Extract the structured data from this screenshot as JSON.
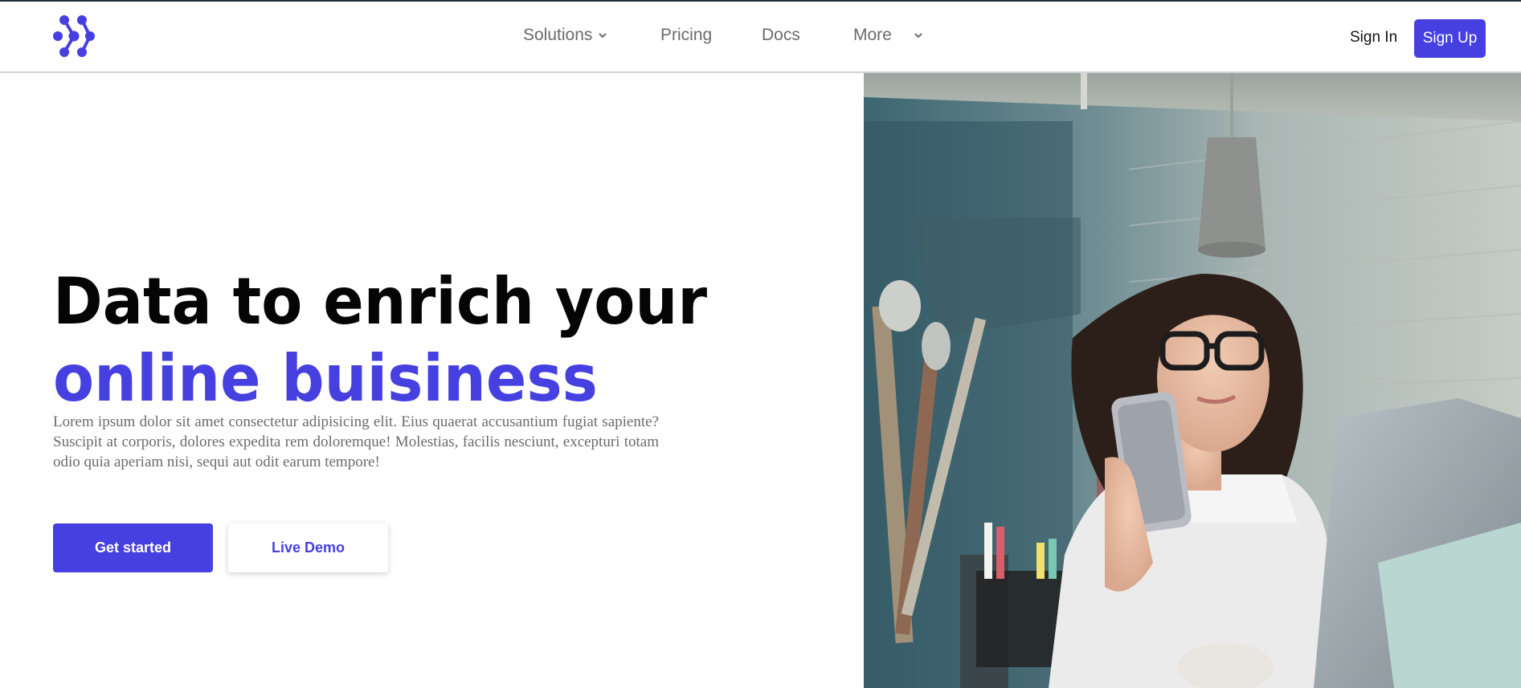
{
  "nav": {
    "logo_icon": "molecule-dots-logo",
    "items": [
      {
        "label": "Solutions",
        "has_dropdown": true
      },
      {
        "label": "Pricing",
        "has_dropdown": false
      },
      {
        "label": "Docs",
        "has_dropdown": false
      },
      {
        "label": "More",
        "has_dropdown": true
      }
    ],
    "sign_in_label": "Sign In",
    "sign_up_label": "Sign Up"
  },
  "hero": {
    "headline_line1": "Data to enrich your",
    "headline_line2": "online buisiness",
    "lead": "Lorem ipsum dolor sit amet consectetur adipisicing elit. Eius quaerat accusantium fugiat sapiente? Suscipit at corporis, dolores expedita rem doloremque! Molestias, facilis nesciunt, excepturi totam odio quia aperiam nisi, sequi aut odit earum tempore!",
    "primary_cta": "Get started",
    "secondary_cta": "Live Demo",
    "image_subject": "woman-with-glasses-using-phone-at-desk"
  },
  "colors": {
    "accent": "#4640e1",
    "text_muted": "#6b6b6b",
    "headline": "#050505"
  }
}
